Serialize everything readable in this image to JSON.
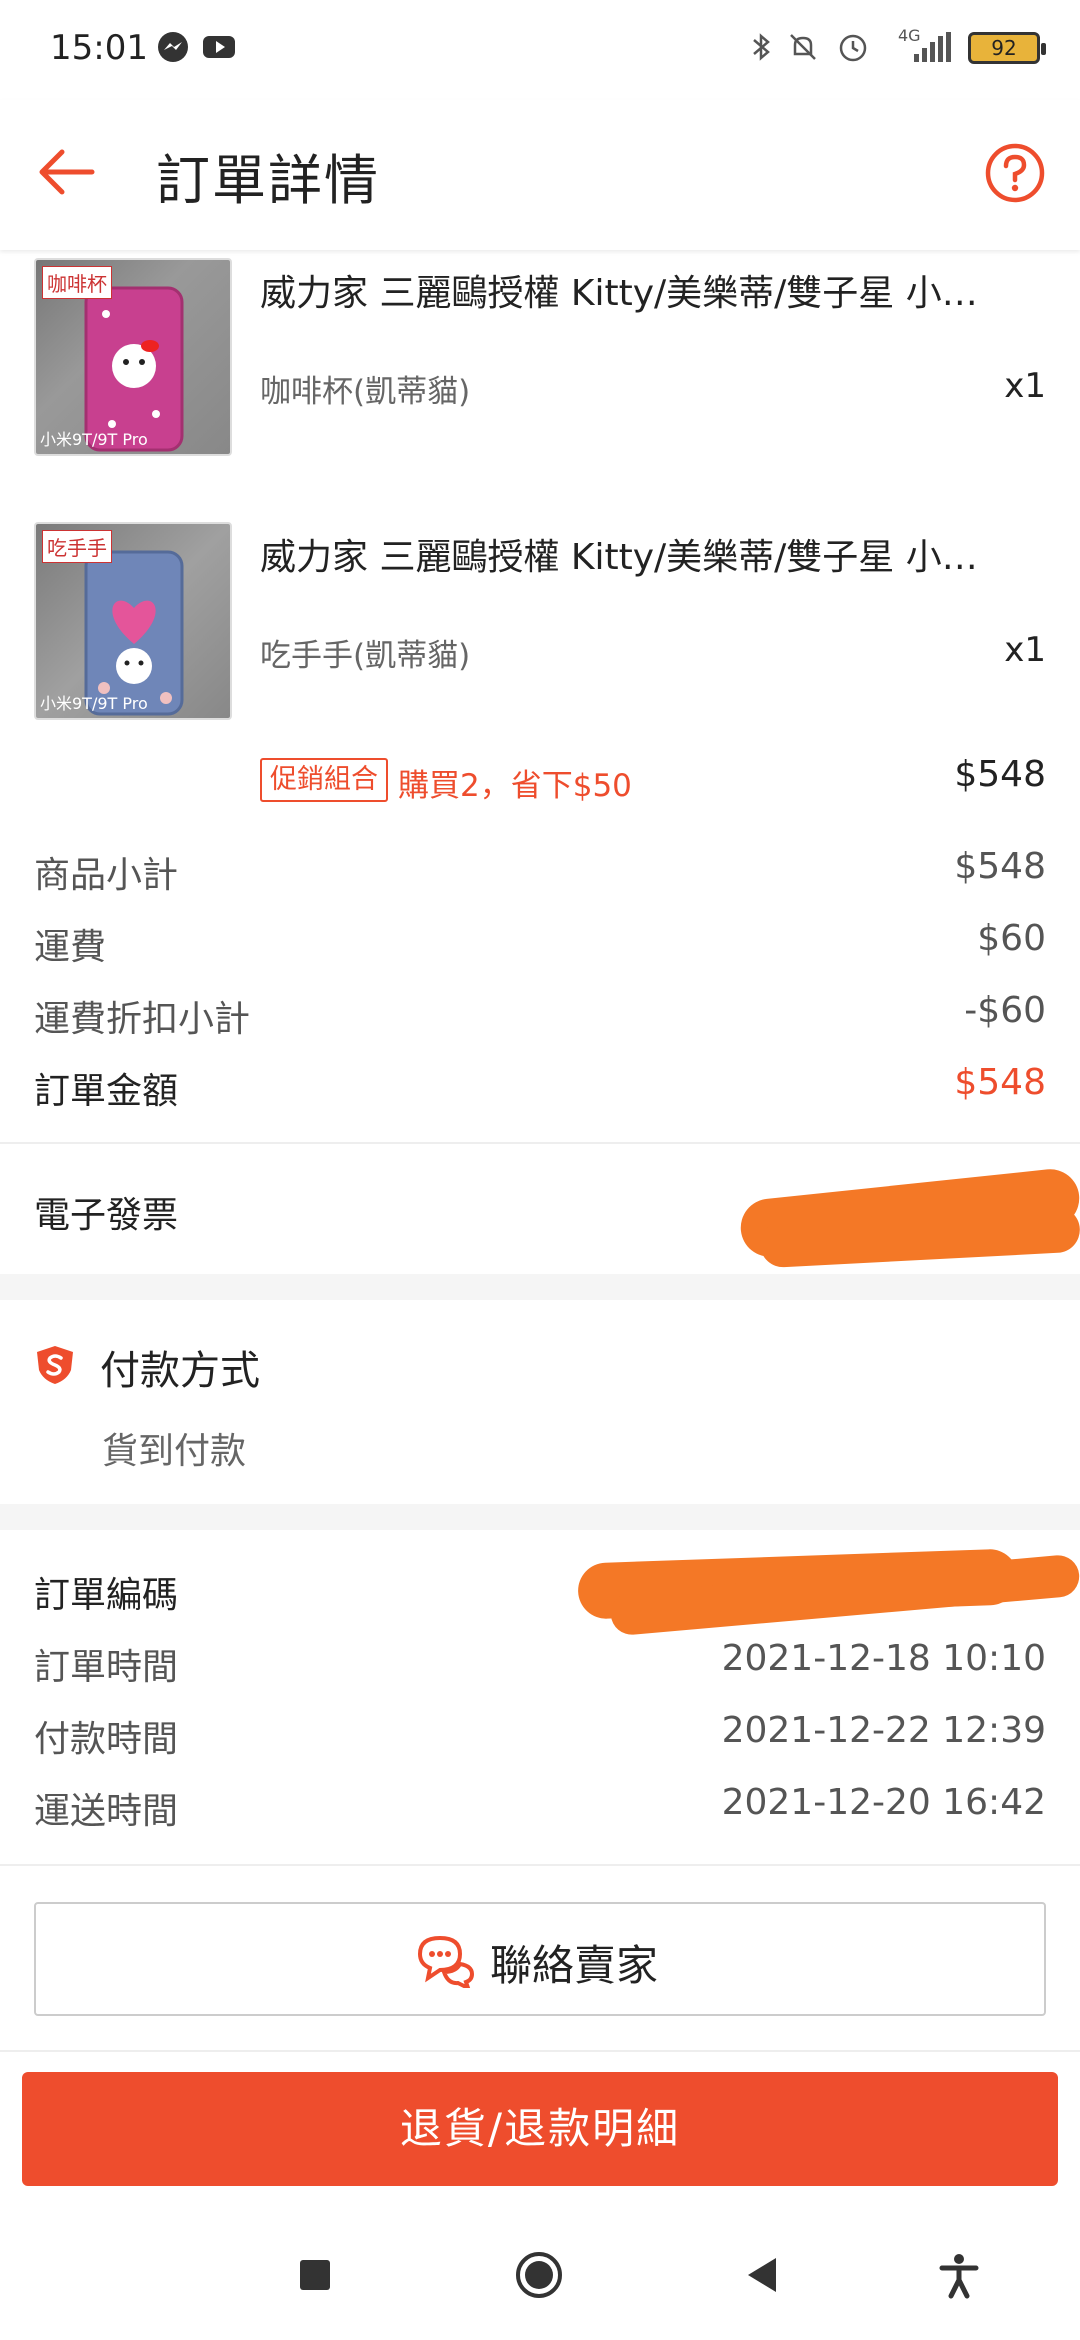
{
  "status_bar": {
    "time": "15:01",
    "battery": "92",
    "network": "4G",
    "icons": [
      "messenger-icon",
      "youtube-icon",
      "bluetooth-icon",
      "mute-icon",
      "alarm-icon",
      "signal-icon",
      "battery-icon"
    ]
  },
  "header": {
    "title": "訂單詳情",
    "back_icon": "back-arrow-icon",
    "help_icon": "help-icon"
  },
  "products": [
    {
      "thumb_label": "咖啡杯",
      "thumb_caption": "小米9T/9T Pro",
      "title": "威力家 三麗鷗授權 Kitty/美樂蒂/雙子星 小…",
      "variant": "咖啡杯(凱蒂貓)",
      "qty": "x1"
    },
    {
      "thumb_label": "吃手手",
      "thumb_caption": "小米9T/9T Pro",
      "title": "威力家 三麗鷗授權 Kitty/美樂蒂/雙子星 小…",
      "variant": "吃手手(凱蒂貓)",
      "qty": "x1"
    }
  ],
  "promo": {
    "tag": "促銷組合",
    "text": "購買2，省下$50",
    "price": "$548"
  },
  "summary": {
    "subtotal_label": "商品小計",
    "subtotal_value": "$548",
    "shipping_label": "運費",
    "shipping_value": "$60",
    "shipping_discount_label": "運費折扣小計",
    "shipping_discount_value": "-$60",
    "total_label": "訂單金額",
    "total_value": "$548"
  },
  "invoice": {
    "label": "電子發票"
  },
  "payment": {
    "title": "付款方式",
    "method": "貨到付款"
  },
  "order_info": {
    "order_no_label": "訂單編碼",
    "order_time_label": "訂單時間",
    "order_time_value": "2021-12-18 10:10",
    "payment_time_label": "付款時間",
    "payment_time_value": "2021-12-22 12:39",
    "shipping_time_label": "運送時間",
    "shipping_time_value": "2021-12-20 16:42"
  },
  "actions": {
    "contact_seller": "聯絡賣家",
    "refund_details": "退貨/退款明細"
  },
  "colors": {
    "accent": "#ee4d2d",
    "redaction": "#f47826"
  }
}
